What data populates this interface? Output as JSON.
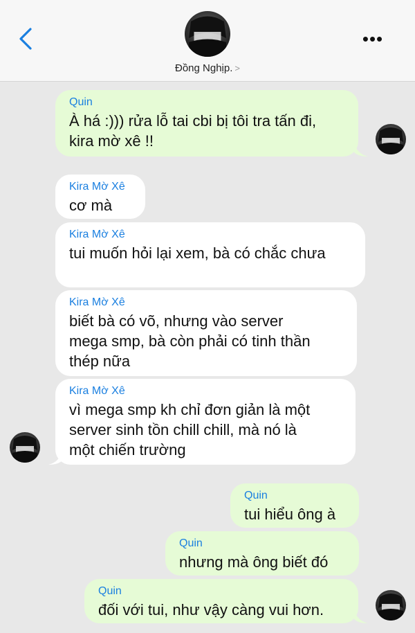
{
  "header": {
    "contact_name": "Đồng Nghịp.",
    "chevron": ">",
    "more": "•••"
  },
  "messages": [
    {
      "sender": "Quin",
      "text_lines": [
        "À há :))) rửa lỗ tai cbi bị tôi tra tấn đi,",
        "kira mờ xê !!"
      ]
    },
    {
      "sender": "Kira Mờ Xê",
      "text_lines": [
        "cơ mà"
      ]
    },
    {
      "sender": "Kira Mờ Xê",
      "text_lines": [
        "tui muốn hỏi lại xem, bà có chắc chưa"
      ]
    },
    {
      "sender": "Kira Mờ Xê",
      "text_lines": [
        "biết bà có võ, nhưng vào server",
        "mega smp, bà còn phải có tinh thần",
        "thép nữa"
      ]
    },
    {
      "sender": "Kira Mờ Xê",
      "text_lines": [
        "vì mega smp kh chỉ đơn giản là một",
        "server sinh tồn chill chill, mà nó là",
        "một chiến trường"
      ]
    },
    {
      "sender": "Quin",
      "text_lines": [
        "tui hiểu ông à"
      ]
    },
    {
      "sender": "Quin",
      "text_lines": [
        "nhưng mà ông biết đó"
      ]
    },
    {
      "sender": "Quin",
      "text_lines": [
        "đối với tui, như vậy càng vui hơn."
      ]
    }
  ],
  "colors": {
    "accent": "#1a7fe0",
    "outgoing_bubble": "#e6fbd6",
    "incoming_bubble": "#ffffff",
    "background": "#e8e8e8"
  },
  "icons": {
    "back": "chevron-left-icon",
    "more": "more-horizontal-icon",
    "avatar": "user-avatar"
  }
}
